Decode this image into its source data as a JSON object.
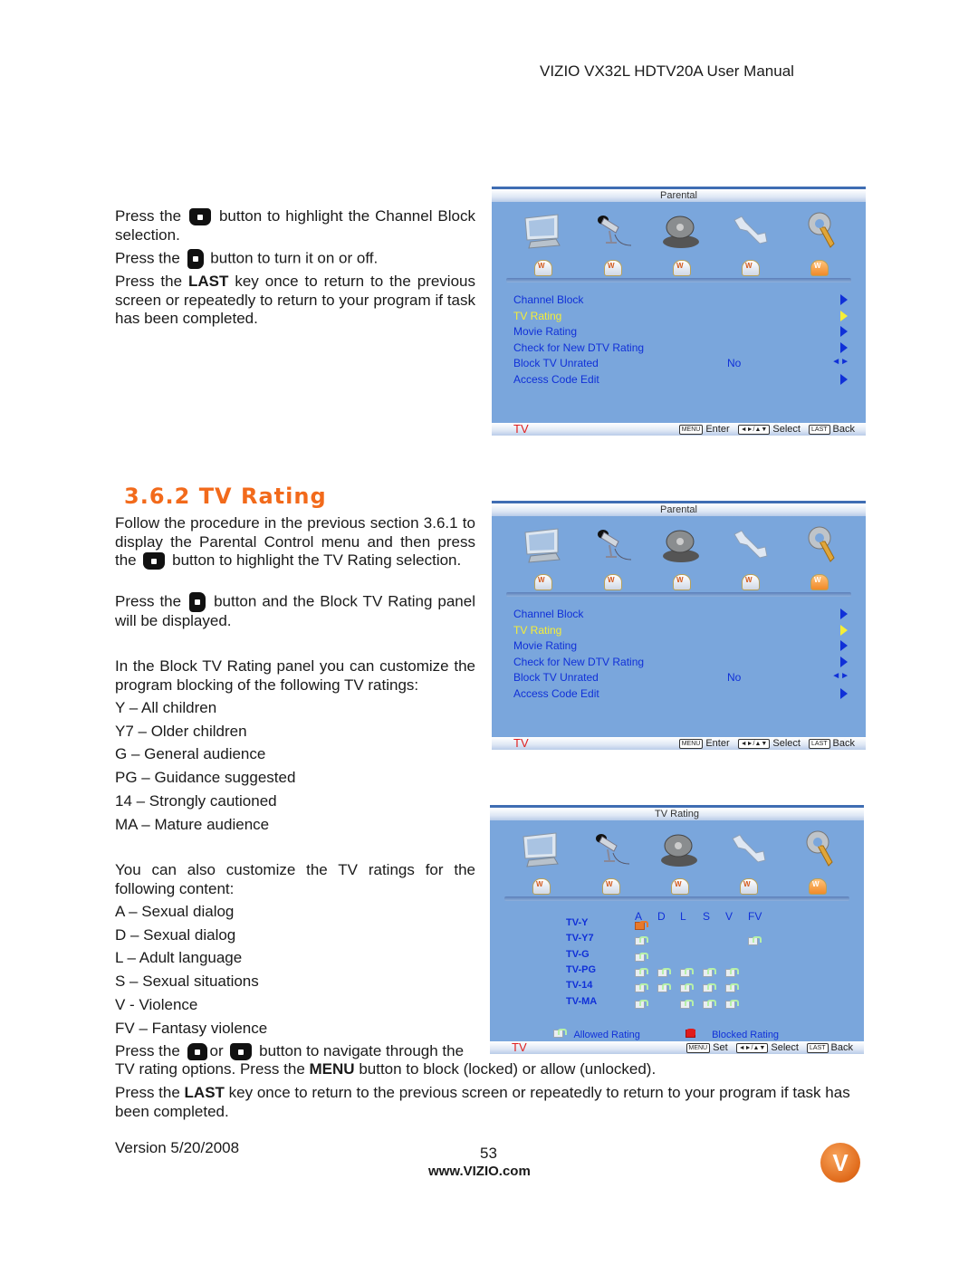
{
  "header": {
    "title": "VIZIO VX32L HDTV20A User Manual"
  },
  "section1": {
    "line1_pre": "Press the",
    "line1_post": "button to highlight the Channel Block selection.",
    "line2_pre": "Press the",
    "line2_post": "button to turn it on or off.",
    "line3_pre": "Press the",
    "line3_bold": "LAST",
    "line3_post": "key once to return to the previous screen or repeatedly to return to your program if task has been completed."
  },
  "section2": {
    "title": "3.6.2 TV Rating",
    "p1_pre": "Follow the procedure in the previous section 3.6.1 to display the Parental Control menu and then press the",
    "p1_post": "button to highlight the TV Rating selection.",
    "p2_pre": "Press the",
    "p2_post": "button and the Block TV Rating panel will be displayed.",
    "p3": "In the Block TV Rating panel you can customize the program blocking of the following TV ratings:",
    "ratings": [
      "Y – All children",
      "Y7 – Older children",
      "G – General audience",
      "PG – Guidance suggested",
      "14 – Strongly cautioned",
      "MA – Mature audience"
    ],
    "p4": "You can also customize the TV ratings for the following content:",
    "content": [
      "A – Sexual dialog",
      "D – Sexual dialog",
      "L – Adult language",
      "S – Sexual situations",
      "V - Violence",
      "FV – Fantasy violence"
    ],
    "p5_pre": "Press the",
    "p5_or": "or",
    "p5_mid": "button to navigate through the",
    "p5_line2_pre": "TV rating options.  Press the",
    "p5_bold": "MENU",
    "p5_line2_post": "button to block (locked) or allow (unlocked).",
    "p6_pre": "Press the",
    "p6_bold": "LAST",
    "p6_post": "key once to return to the previous screen or repeatedly to return to your program if task has been completed."
  },
  "osd_parental": {
    "title": "Parental",
    "icons": [
      "tv-icon",
      "microphone-icon",
      "satellite-dish-icon",
      "wrench-icon",
      "keys-icon"
    ],
    "active_icon": 4,
    "items": [
      {
        "label": "Channel Block",
        "value": "",
        "control": "arrow",
        "highlighted": false
      },
      {
        "label": "TV Rating",
        "value": "",
        "control": "arrow",
        "highlighted": true
      },
      {
        "label": "Movie Rating",
        "value": "",
        "control": "arrow",
        "highlighted": false
      },
      {
        "label": "Check for New DTV Rating",
        "value": "",
        "control": "arrow",
        "highlighted": false
      },
      {
        "label": "Block TV Unrated",
        "value": "No",
        "control": "left-right",
        "highlighted": false
      },
      {
        "label": "Access Code Edit",
        "value": "",
        "control": "arrow",
        "highlighted": false
      }
    ],
    "footer": {
      "source": "TV",
      "menu_key": "MENU",
      "menu_action": "Enter",
      "nav_key": "◄►/▲▼",
      "nav_action": "Select",
      "last_key": "LAST",
      "last_action": "Back"
    }
  },
  "osd_rating": {
    "title": "TV Rating",
    "columns": [
      "A",
      "D",
      "L",
      "S",
      "V",
      "FV"
    ],
    "rows": [
      {
        "label": "TV-Y",
        "cells": [
          "open",
          "",
          "",
          "",
          "",
          ""
        ]
      },
      {
        "label": "TV-Y7",
        "cells": [
          "allowed",
          "",
          "",
          "",
          "",
          "allowed"
        ]
      },
      {
        "label": "TV-G",
        "cells": [
          "allowed",
          "",
          "",
          "",
          "",
          ""
        ]
      },
      {
        "label": "TV-PG",
        "cells": [
          "allowed",
          "allowed",
          "allowed",
          "allowed",
          "allowed",
          ""
        ]
      },
      {
        "label": "TV-14",
        "cells": [
          "allowed",
          "allowed",
          "allowed",
          "allowed",
          "allowed",
          ""
        ]
      },
      {
        "label": "TV-MA",
        "cells": [
          "allowed",
          "",
          "allowed",
          "allowed",
          "allowed",
          ""
        ]
      }
    ],
    "legend_allowed": "Allowed Rating",
    "legend_blocked": "Blocked Rating",
    "footer": {
      "source": "TV",
      "menu_key": "MENU",
      "menu_action": "Set",
      "nav_key": "◄►/▲▼",
      "nav_action": "Select",
      "last_key": "LAST",
      "last_action": "Back"
    }
  },
  "footer": {
    "version": "Version 5/20/2008",
    "page": "53",
    "url": "www.VIZIO.com",
    "logo_letter": "V"
  }
}
